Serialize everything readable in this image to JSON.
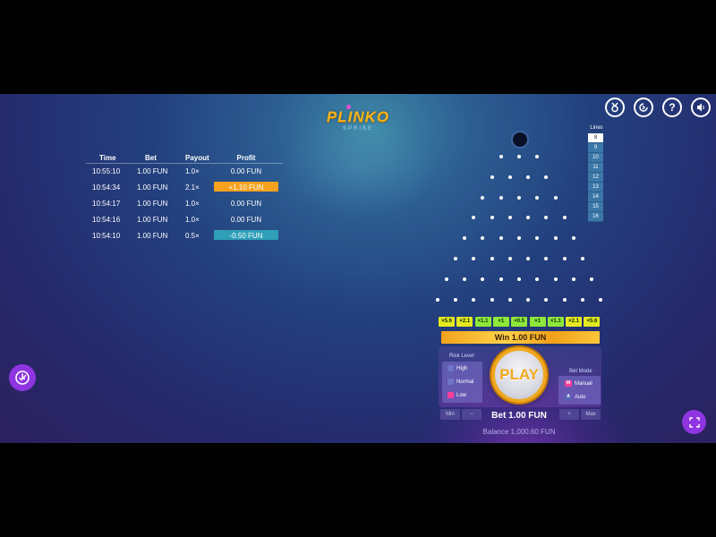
{
  "logo": {
    "title": "PLINKO",
    "subtitle": "SPRIBE"
  },
  "top_icons": [
    "medal-icon",
    "replay-icon",
    "help-icon",
    "sound-icon"
  ],
  "history": {
    "headers": {
      "time": "Time",
      "bet": "Bet",
      "payout": "Payout",
      "profit": "Profit"
    },
    "rows": [
      {
        "time": "10:55:10",
        "bet": "1.00 FUN",
        "payout": "1.0×",
        "profit": "0.00 FUN",
        "style": "none"
      },
      {
        "time": "10:54:34",
        "bet": "1.00 FUN",
        "payout": "2.1×",
        "profit": "+1.10 FUN",
        "style": "win"
      },
      {
        "time": "10:54:17",
        "bet": "1.00 FUN",
        "payout": "1.0×",
        "profit": "0.00 FUN",
        "style": "none"
      },
      {
        "time": "10:54:16",
        "bet": "1.00 FUN",
        "payout": "1.0×",
        "profit": "0.00 FUN",
        "style": "none"
      },
      {
        "time": "10:54:10",
        "bet": "1.00 FUN",
        "payout": "0.5×",
        "profit": "-0.50 FUN",
        "style": "loss"
      }
    ]
  },
  "lines": {
    "label": "Lines",
    "options": [
      "8",
      "9",
      "10",
      "11",
      "12",
      "13",
      "14",
      "15",
      "16"
    ],
    "selected": "8"
  },
  "multipliers": [
    "×5.6",
    "×2.1",
    "×1.1",
    "×1",
    "×0.5",
    "×1",
    "×1.1",
    "×2.1",
    "×5.6"
  ],
  "win_text": "Win 1.00 FUN",
  "risk": {
    "title": "Risk Level",
    "options": [
      "High",
      "Normal",
      "Low"
    ],
    "selected": "Low"
  },
  "play_label": "PLAY",
  "bet_mode": {
    "title": "Bet Mode",
    "options": [
      {
        "key": "M",
        "label": "Manual"
      },
      {
        "key": "A",
        "label": "Auto"
      }
    ],
    "selected": "Manual"
  },
  "bet_controls": {
    "min": "Min",
    "minus": "−",
    "plus": "+",
    "max": "Max"
  },
  "bet_text": "Bet 1.00 FUN",
  "balance_text": "Balance 1,000.60 FUN",
  "colors": {
    "win_profit": "#f5a21f",
    "loss_profit": "#2f9fb8",
    "mult_edge": "#e5ea20",
    "mult_mid": "#8ee83a",
    "accent_purple": "#8e34e0"
  }
}
